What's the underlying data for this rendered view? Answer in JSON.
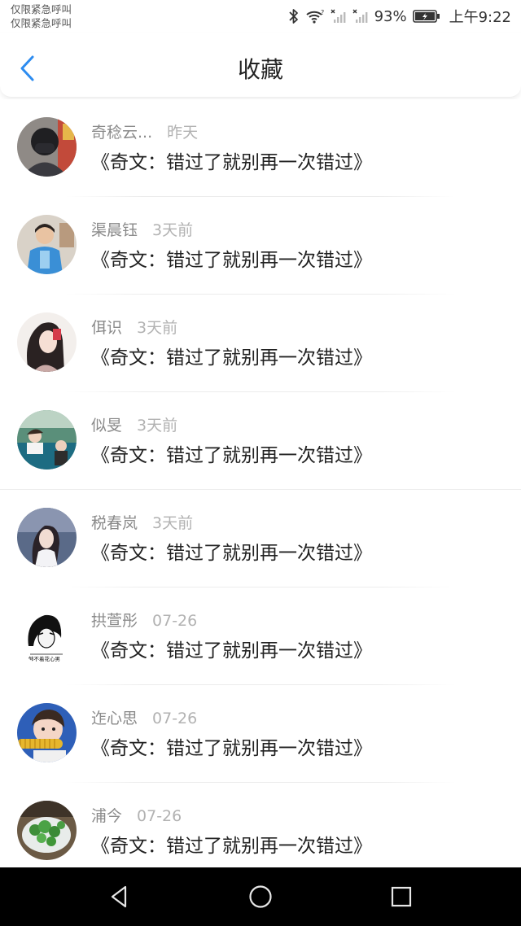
{
  "status_bar": {
    "carrier_line1": "仅限紧急呼叫",
    "carrier_line2": "仅限紧急呼叫",
    "battery": "93%",
    "time": "上午9:22"
  },
  "header": {
    "title": "收藏"
  },
  "list": [
    {
      "name": "奇稔云...",
      "time": "昨天",
      "title": "《奇文：错过了就别再一次错过》",
      "avatar": "avatar-1"
    },
    {
      "name": "渠晨钰",
      "time": "3天前",
      "title": "《奇文：错过了就别再一次错过》",
      "avatar": "avatar-2"
    },
    {
      "name": "佴识",
      "time": "3天前",
      "title": "《奇文：错过了就别再一次错过》",
      "avatar": "avatar-3"
    },
    {
      "name": "似旻",
      "time": "3天前",
      "title": "《奇文：错过了就别再一次错过》",
      "avatar": "avatar-4"
    },
    {
      "name": "税春岚",
      "time": "3天前",
      "title": "《奇文：错过了就别再一次错过》",
      "avatar": "avatar-5"
    },
    {
      "name": "拱萱彤",
      "time": "07-26",
      "title": "《奇文：错过了就别再一次错过》",
      "avatar": "avatar-6",
      "avatar_caption": "够不着花心男"
    },
    {
      "name": "迮心思",
      "time": "07-26",
      "title": "《奇文：错过了就别再一次错过》",
      "avatar": "avatar-7"
    },
    {
      "name": "浦今",
      "time": "07-26",
      "title": "《奇文：错过了就别再一次错过》",
      "avatar": "avatar-8"
    }
  ],
  "nav_bar": {
    "icons": [
      "back-triangle-icon",
      "home-circle-icon",
      "recents-square-icon"
    ]
  },
  "colors": {
    "accent": "#2d8cf0",
    "title_text": "#222222",
    "name_text": "#8a8a8a",
    "time_text": "#b2b2b2"
  }
}
